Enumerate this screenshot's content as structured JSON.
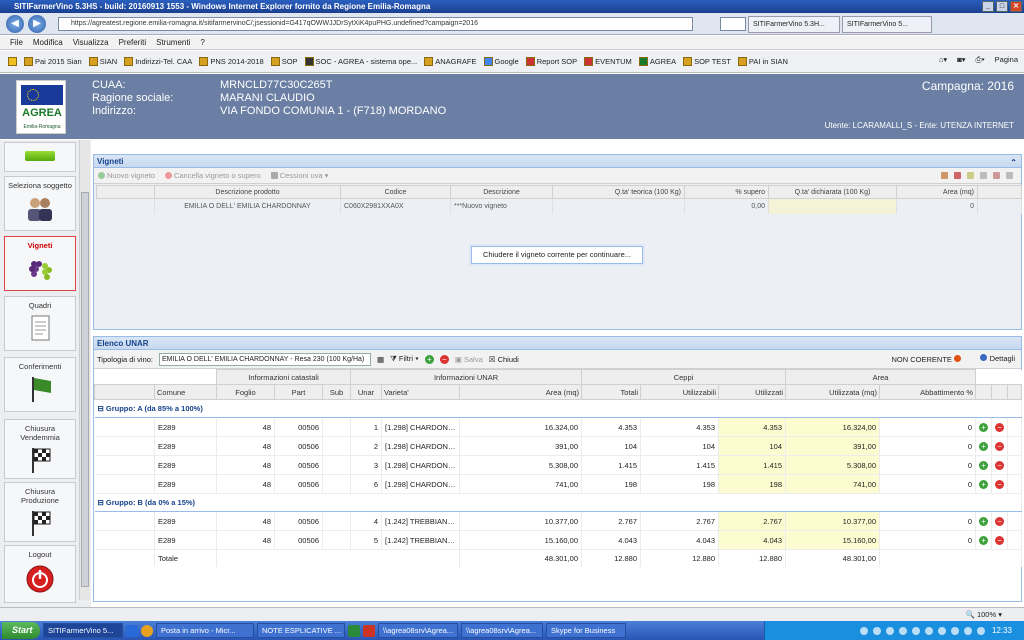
{
  "window": {
    "title": "SITIFarmerVino 5.3HS - build: 20160913 1553 - Windows Internet Explorer fornito da Regione Emilia-Romagna"
  },
  "browser": {
    "url": "https://agreatest.regione.emilia-romagna.it/sitifarmervinoC/;jsessionid=G417qOWWJJDrSytXiK4puPHG.undefined?campaign=2016",
    "tabs": [
      "SITIFarmerVino 5.3H...",
      "SITIFarmerVino 5..."
    ],
    "menu": [
      "File",
      "Modifica",
      "Visualizza",
      "Preferiti",
      "Strumenti",
      "?"
    ],
    "favorites": [
      "Pai 2015 Sian",
      "SIAN",
      "Indirizzi-Tel. CAA",
      "PNS 2014-2018",
      "SOP",
      "SOC - AGREA - sistema ope...",
      "ANAGRAFE",
      "Google",
      "Report SOP",
      "EVENTUM",
      "AGREA",
      "SOP TEST",
      "PAI in SIAN"
    ],
    "page_menu": "Pagina"
  },
  "header": {
    "cuaa_label": "CUAA:",
    "cuaa": "MRNCLD77C30C265T",
    "ragione_label": "Ragione sociale:",
    "ragione": "MARANI CLAUDIO",
    "indirizzo_label": "Indirizzo:",
    "indirizzo": "VIA FONDO COMUNIA 1 - (F718) MORDANO",
    "campagna": "Campagna: 2016",
    "utente": "Utente: LCARAMALLI_S - Ente: UTENZA INTERNET",
    "logo_text": "AGREA",
    "logo_sub": "Emilia-Romagna"
  },
  "sidebar": [
    {
      "label": "Seleziona soggetto"
    },
    {
      "label": "Vigneti",
      "active": true
    },
    {
      "label": "Quadri"
    },
    {
      "label": "Conferimenti"
    },
    {
      "label": "Chiusura Vendemmia"
    },
    {
      "label": "Chiusura Produzione"
    },
    {
      "label": "Logout"
    }
  ],
  "vigneti": {
    "title": "Vigneti",
    "toolbar": [
      "Nuovo vigneto",
      "Cancella vigneto o supero",
      "Cessioni uva"
    ],
    "columns": [
      "Descrizione prodotto",
      "Codice",
      "Descrizione",
      "Q.ta' teorica (100 Kg)",
      "% supero",
      "Q.ta' dichiarata (100 Kg)",
      "Area (mq)"
    ],
    "row": {
      "prodotto": "EMILIA O DELL' EMILIA CHARDONNAY",
      "codice": "C060X2981XXA0X",
      "descrizione": "***Nuovo vigneto",
      "supero": "0,00",
      "area": "0"
    },
    "close_message": "Chiudere il vigneto corrente per continuare..."
  },
  "unar": {
    "title": "Elenco UNAR",
    "tipologia_label": "Tipologia di vino:",
    "tipologia_value": "EMILIA O DELL' EMILIA CHARDONNAY - Resa 230 (100 Kg/Ha)",
    "filtri": "Filtri",
    "salva": "Salva",
    "chiudi": "Chiudi",
    "non_coerente": "NON COERENTE",
    "dettagli": "Dettagli",
    "group_headers": [
      "Informazioni catastali",
      "Informazioni UNAR",
      "Ceppi",
      "Area"
    ],
    "columns": [
      "Comune",
      "Foglio",
      "Part",
      "Sub",
      "Unar",
      "Varieta'",
      "Area (mq)",
      "Totali",
      "Utilizzabili",
      "Utilizzati",
      "Utilizzata (mq)",
      "Abbattimento %"
    ],
    "groups": [
      {
        "label": "Gruppo: A (da 85% a 100%)",
        "rows": [
          [
            "E289",
            "48",
            "00506",
            "",
            "1",
            "[1.298] CHARDONNAY B.",
            "16.324,00",
            "4.353",
            "4.353",
            "4.353",
            "16.324,00",
            "0"
          ],
          [
            "E289",
            "48",
            "00506",
            "",
            "2",
            "[1.298] CHARDONNAY B.",
            "391,00",
            "104",
            "104",
            "104",
            "391,00",
            "0"
          ],
          [
            "E289",
            "48",
            "00506",
            "",
            "3",
            "[1.298] CHARDONNAY B.",
            "5.308,00",
            "1.415",
            "1.415",
            "1.415",
            "5.308,00",
            "0"
          ],
          [
            "E289",
            "48",
            "00506",
            "",
            "6",
            "[1.298] CHARDONNAY B.",
            "741,00",
            "198",
            "198",
            "198",
            "741,00",
            "0"
          ]
        ]
      },
      {
        "label": "Gruppo: B (da 0% a 15%)",
        "rows": [
          [
            "E289",
            "48",
            "00506",
            "",
            "4",
            "[1.242] TREBBIANO ROMA...",
            "10.377,00",
            "2.767",
            "2.767",
            "2.767",
            "10.377,00",
            "0"
          ],
          [
            "E289",
            "48",
            "00506",
            "",
            "5",
            "[1.242] TREBBIANO ROMA...",
            "15.160,00",
            "4.043",
            "4.043",
            "4.043",
            "15.160,00",
            "0"
          ]
        ]
      }
    ],
    "totale": {
      "label": "Totale",
      "area": "48.301,00",
      "totali": "12.880",
      "utilizzabili": "12.880",
      "utilizzati": "12.880",
      "utilizzata": "48.301,00"
    }
  },
  "status": {
    "zoom": "100%"
  },
  "taskbar": {
    "start": "Start",
    "items": [
      "SITIFarmerVino 5...",
      "",
      "",
      "Posta in arrivo - Micr...",
      "NOTE ESPLICATIVE ...",
      "",
      "",
      "\\\\agrea08srv\\Agrea...",
      "\\\\agrea08srv\\Agrea...",
      "Skype for Business"
    ],
    "clock": "12:33"
  },
  "colors": {
    "header": "#6a7fa3",
    "panel_border": "#99bbe8",
    "highlight": "#fdfbd0",
    "active_nav": "#cc0000"
  }
}
